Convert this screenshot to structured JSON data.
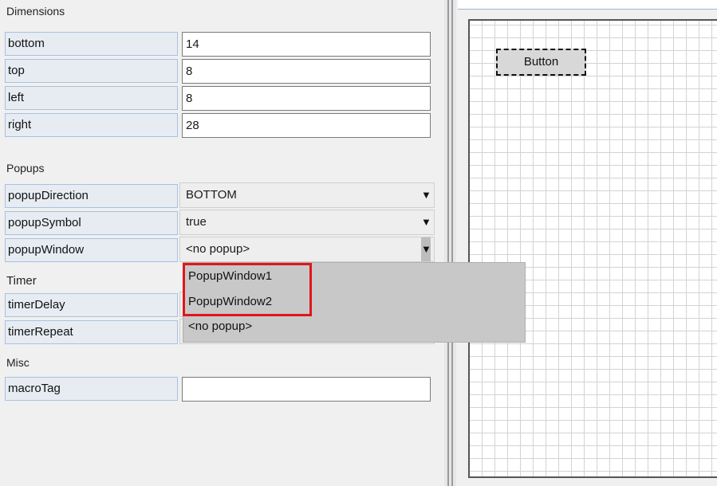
{
  "sections": {
    "dimensions": "Dimensions",
    "popups": "Popups",
    "timer": "Timer",
    "misc": "Misc"
  },
  "dimensions": [
    {
      "label": "bottom",
      "value": "14"
    },
    {
      "label": "top",
      "value": "8"
    },
    {
      "label": "left",
      "value": "8"
    },
    {
      "label": "right",
      "value": "28"
    }
  ],
  "popups": [
    {
      "label": "popupDirection",
      "value": "BOTTOM"
    },
    {
      "label": "popupSymbol",
      "value": "true"
    },
    {
      "label": "popupWindow",
      "value": "<no popup>"
    }
  ],
  "timer": [
    {
      "label": "timerDelay"
    },
    {
      "label": "timerRepeat"
    }
  ],
  "misc": [
    {
      "label": "macroTag",
      "value": ""
    }
  ],
  "dropdown_arrow": "▼",
  "dropdown_options": [
    "PopupWindow1",
    "PopupWindow2",
    "<no popup>"
  ],
  "canvas": {
    "button_label": "Button"
  },
  "colors": {
    "highlight": "#e0161b",
    "label_bg": "#e7ecf3",
    "label_border": "#a9c1df"
  }
}
